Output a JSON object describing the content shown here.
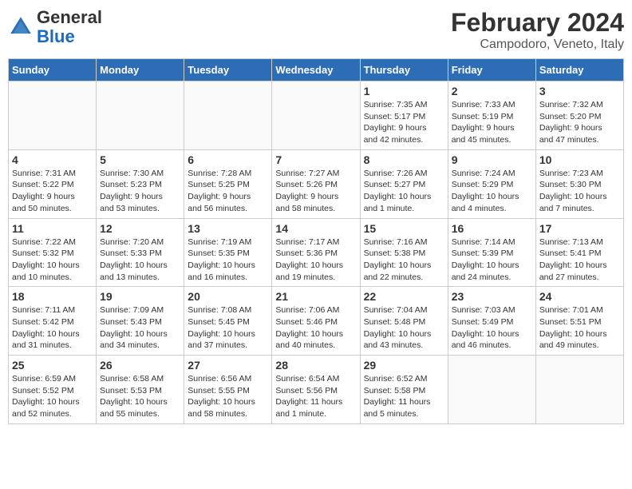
{
  "header": {
    "logo": {
      "general": "General",
      "blue": "Blue"
    },
    "title": "February 2024",
    "location": "Campodoro, Veneto, Italy"
  },
  "calendar": {
    "days_of_week": [
      "Sunday",
      "Monday",
      "Tuesday",
      "Wednesday",
      "Thursday",
      "Friday",
      "Saturday"
    ],
    "weeks": [
      [
        {
          "day": "",
          "info": ""
        },
        {
          "day": "",
          "info": ""
        },
        {
          "day": "",
          "info": ""
        },
        {
          "day": "",
          "info": ""
        },
        {
          "day": "1",
          "info": "Sunrise: 7:35 AM\nSunset: 5:17 PM\nDaylight: 9 hours\nand 42 minutes."
        },
        {
          "day": "2",
          "info": "Sunrise: 7:33 AM\nSunset: 5:19 PM\nDaylight: 9 hours\nand 45 minutes."
        },
        {
          "day": "3",
          "info": "Sunrise: 7:32 AM\nSunset: 5:20 PM\nDaylight: 9 hours\nand 47 minutes."
        }
      ],
      [
        {
          "day": "4",
          "info": "Sunrise: 7:31 AM\nSunset: 5:22 PM\nDaylight: 9 hours\nand 50 minutes."
        },
        {
          "day": "5",
          "info": "Sunrise: 7:30 AM\nSunset: 5:23 PM\nDaylight: 9 hours\nand 53 minutes."
        },
        {
          "day": "6",
          "info": "Sunrise: 7:28 AM\nSunset: 5:25 PM\nDaylight: 9 hours\nand 56 minutes."
        },
        {
          "day": "7",
          "info": "Sunrise: 7:27 AM\nSunset: 5:26 PM\nDaylight: 9 hours\nand 58 minutes."
        },
        {
          "day": "8",
          "info": "Sunrise: 7:26 AM\nSunset: 5:27 PM\nDaylight: 10 hours\nand 1 minute."
        },
        {
          "day": "9",
          "info": "Sunrise: 7:24 AM\nSunset: 5:29 PM\nDaylight: 10 hours\nand 4 minutes."
        },
        {
          "day": "10",
          "info": "Sunrise: 7:23 AM\nSunset: 5:30 PM\nDaylight: 10 hours\nand 7 minutes."
        }
      ],
      [
        {
          "day": "11",
          "info": "Sunrise: 7:22 AM\nSunset: 5:32 PM\nDaylight: 10 hours\nand 10 minutes."
        },
        {
          "day": "12",
          "info": "Sunrise: 7:20 AM\nSunset: 5:33 PM\nDaylight: 10 hours\nand 13 minutes."
        },
        {
          "day": "13",
          "info": "Sunrise: 7:19 AM\nSunset: 5:35 PM\nDaylight: 10 hours\nand 16 minutes."
        },
        {
          "day": "14",
          "info": "Sunrise: 7:17 AM\nSunset: 5:36 PM\nDaylight: 10 hours\nand 19 minutes."
        },
        {
          "day": "15",
          "info": "Sunrise: 7:16 AM\nSunset: 5:38 PM\nDaylight: 10 hours\nand 22 minutes."
        },
        {
          "day": "16",
          "info": "Sunrise: 7:14 AM\nSunset: 5:39 PM\nDaylight: 10 hours\nand 24 minutes."
        },
        {
          "day": "17",
          "info": "Sunrise: 7:13 AM\nSunset: 5:41 PM\nDaylight: 10 hours\nand 27 minutes."
        }
      ],
      [
        {
          "day": "18",
          "info": "Sunrise: 7:11 AM\nSunset: 5:42 PM\nDaylight: 10 hours\nand 31 minutes."
        },
        {
          "day": "19",
          "info": "Sunrise: 7:09 AM\nSunset: 5:43 PM\nDaylight: 10 hours\nand 34 minutes."
        },
        {
          "day": "20",
          "info": "Sunrise: 7:08 AM\nSunset: 5:45 PM\nDaylight: 10 hours\nand 37 minutes."
        },
        {
          "day": "21",
          "info": "Sunrise: 7:06 AM\nSunset: 5:46 PM\nDaylight: 10 hours\nand 40 minutes."
        },
        {
          "day": "22",
          "info": "Sunrise: 7:04 AM\nSunset: 5:48 PM\nDaylight: 10 hours\nand 43 minutes."
        },
        {
          "day": "23",
          "info": "Sunrise: 7:03 AM\nSunset: 5:49 PM\nDaylight: 10 hours\nand 46 minutes."
        },
        {
          "day": "24",
          "info": "Sunrise: 7:01 AM\nSunset: 5:51 PM\nDaylight: 10 hours\nand 49 minutes."
        }
      ],
      [
        {
          "day": "25",
          "info": "Sunrise: 6:59 AM\nSunset: 5:52 PM\nDaylight: 10 hours\nand 52 minutes."
        },
        {
          "day": "26",
          "info": "Sunrise: 6:58 AM\nSunset: 5:53 PM\nDaylight: 10 hours\nand 55 minutes."
        },
        {
          "day": "27",
          "info": "Sunrise: 6:56 AM\nSunset: 5:55 PM\nDaylight: 10 hours\nand 58 minutes."
        },
        {
          "day": "28",
          "info": "Sunrise: 6:54 AM\nSunset: 5:56 PM\nDaylight: 11 hours\nand 1 minute."
        },
        {
          "day": "29",
          "info": "Sunrise: 6:52 AM\nSunset: 5:58 PM\nDaylight: 11 hours\nand 5 minutes."
        },
        {
          "day": "",
          "info": ""
        },
        {
          "day": "",
          "info": ""
        }
      ]
    ]
  }
}
